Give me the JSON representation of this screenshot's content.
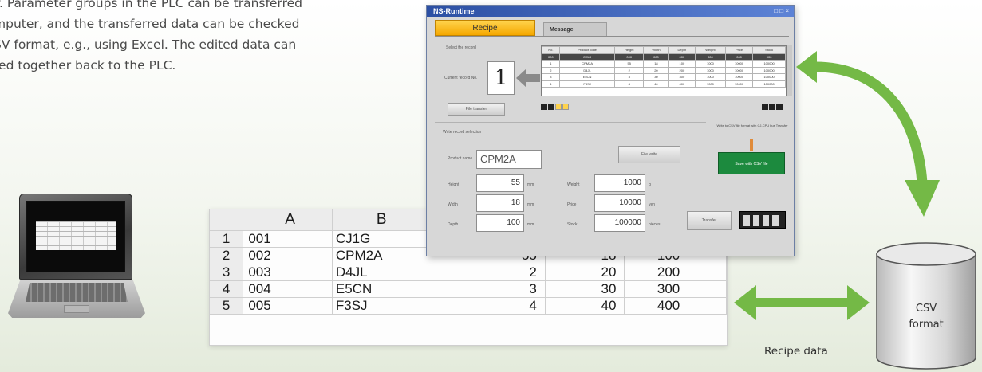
{
  "intro": {
    "lines": [
      "y. Parameter groups in the PLC can be transferred",
      "mputer, and the transferred data can be checked",
      "SV format, e.g., using Excel. The edited data can",
      "red together back to the PLC."
    ]
  },
  "spreadsheet": {
    "col_headers": [
      "",
      "A",
      "B",
      "",
      "",
      "",
      ""
    ],
    "rows": [
      {
        "n": "1",
        "a": "001",
        "b": "CJ1G",
        "c": "",
        "d": "",
        "e": ""
      },
      {
        "n": "2",
        "a": "002",
        "b": "CPM2A",
        "c": "55",
        "d": "18",
        "e": "100"
      },
      {
        "n": "3",
        "a": "003",
        "b": "D4JL",
        "c": "2",
        "d": "20",
        "e": "200"
      },
      {
        "n": "4",
        "a": "004",
        "b": "E5CN",
        "c": "3",
        "d": "30",
        "e": "300"
      },
      {
        "n": "5",
        "a": "005",
        "b": "F3SJ",
        "c": "4",
        "d": "40",
        "e": "400"
      }
    ]
  },
  "runtime_window": {
    "title": "NS-Runtime",
    "window_controls": "□ □ ×",
    "tab_recipe": "Recipe",
    "tab_message": "Message",
    "selected_label": "Select the record",
    "record_label": "Current record No.",
    "record_number": "1",
    "file_button": "File transfer",
    "grid": {
      "headers": [
        "No.",
        "Product code",
        "Height",
        "Width",
        "Depth",
        "Weight",
        "Price",
        "Stock"
      ],
      "rows": [
        [
          "000",
          "CJ1G",
          "000",
          "000",
          "000",
          "000",
          "000",
          "000"
        ],
        [
          "1",
          "CPM2A",
          "55",
          "18",
          "100",
          "1000",
          "10000",
          "100000"
        ],
        [
          "2",
          "D4JL",
          "2",
          "20",
          "200",
          "1000",
          "10000",
          "100000"
        ],
        [
          "3",
          "E5CN",
          "3",
          "30",
          "300",
          "1000",
          "10000",
          "100000"
        ],
        [
          "4",
          "F3SJ",
          "4",
          "40",
          "400",
          "1000",
          "10000",
          "100000"
        ]
      ]
    },
    "write_label": "Write record selection",
    "product_label": "Product name",
    "product_name": "CPM2A",
    "file_write_button": "File write",
    "height_label": "Height",
    "height_value": "55",
    "height_unit": "mm",
    "width_label": "Width",
    "width_value": "18",
    "width_unit": "mm",
    "depth_label": "Depth",
    "depth_value": "100",
    "depth_unit": "mm",
    "weight_label": "Weight",
    "weight_value": "1000",
    "weight_unit": "g",
    "price_label": "Price",
    "price_value": "10000",
    "price_unit": "yen",
    "stock_label": "Stock",
    "stock_value": "100000",
    "stock_unit": "pieces",
    "note_text": "Write to CSV file format with CJ-CPU bus Transfer",
    "green_button": "Save with CSV file",
    "transfer_button": "Transfer"
  },
  "csv_label_line1": "CSV",
  "csv_label_line2": "format",
  "recipe_data_label": "Recipe data",
  "colors": {
    "arrow_green": "#74b946",
    "tab_yellow": "#f5a800",
    "title_blue": "#2c4fa3",
    "green_button": "#1c8a3e"
  }
}
